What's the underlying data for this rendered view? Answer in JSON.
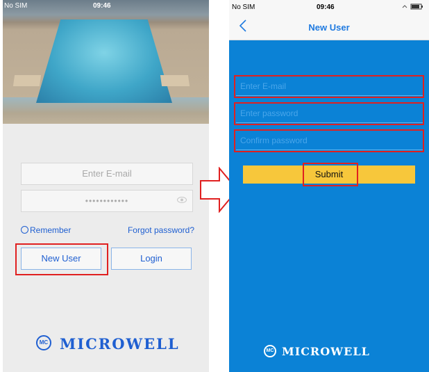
{
  "left_screen": {
    "status": {
      "carrier": "No SIM",
      "time": "09:46"
    },
    "email_placeholder": "Enter E-mail",
    "password_mask": "••••••••••••",
    "remember_label": "Remember",
    "forgot_label": "Forgot password?",
    "new_user_label": "New User",
    "login_label": "Login",
    "brand": "MICROWELL"
  },
  "right_screen": {
    "status": {
      "carrier": "No SIM",
      "time": "09:46"
    },
    "title": "New User",
    "email_placeholder": "Enter E-mail",
    "password_placeholder": "Enter password",
    "confirm_placeholder": "Confirm password",
    "submit_label": "Submit",
    "brand": "MICROWELL"
  },
  "colors": {
    "accent_blue": "#1f5fd1",
    "right_background": "#0b82d6",
    "submit_yellow": "#f7c73b",
    "highlight_red": "#e02020"
  },
  "icons": {
    "eye": "eye-icon",
    "back": "back-chevron-icon",
    "radio": "radio-icon",
    "arrow": "right-arrow-icon",
    "wifi": "wifi-icon",
    "battery": "battery-icon",
    "logo": "microwell-logo-icon"
  }
}
